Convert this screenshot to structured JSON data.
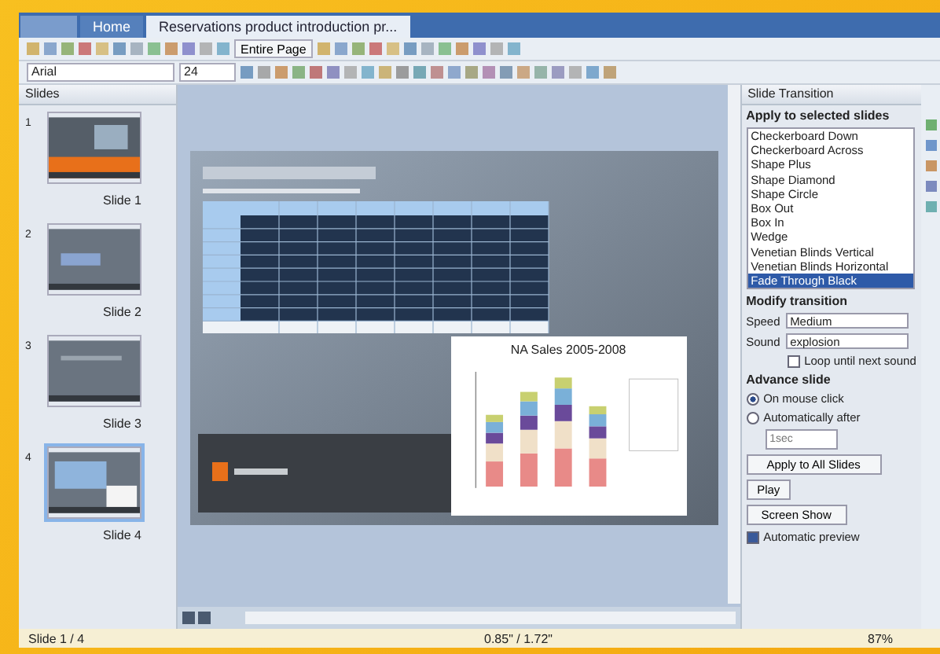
{
  "tabs": [
    {
      "label": "Home",
      "selected": false
    },
    {
      "label": "Reservations product introduction pr...",
      "selected": true
    }
  ],
  "toolbar": {
    "zoom_label": "Entire Page",
    "font": "Arial",
    "font_size": "24"
  },
  "slides_panel": {
    "title": "Slides",
    "slides": [
      {
        "number": "1",
        "label": "Slide 1",
        "selected": false
      },
      {
        "number": "2",
        "label": "Slide 2",
        "selected": false
      },
      {
        "number": "3",
        "label": "Slide 3",
        "selected": false
      },
      {
        "number": "4",
        "label": "Slide 4",
        "selected": true
      }
    ]
  },
  "slide": {
    "chart_title": "NA Sales 2005-2008"
  },
  "transition_panel": {
    "title": "Slide Transition",
    "apply_heading": "Apply to selected slides",
    "effects": [
      {
        "label": "Checkerboard Down",
        "selected": false
      },
      {
        "label": "Checkerboard Across",
        "selected": false
      },
      {
        "label": "Shape Plus",
        "selected": false
      },
      {
        "label": "Shape Diamond",
        "selected": false
      },
      {
        "label": "Shape Circle",
        "selected": false
      },
      {
        "label": "Box Out",
        "selected": false
      },
      {
        "label": "Box In",
        "selected": false
      },
      {
        "label": "Wedge",
        "selected": false
      },
      {
        "label": "Venetian Blinds Vertical",
        "selected": false
      },
      {
        "label": "Venetian Blinds Horizontal",
        "selected": false
      },
      {
        "label": "Fade Through Black",
        "selected": true
      }
    ],
    "modify_heading": "Modify transition",
    "speed_label": "Speed",
    "speed": "Medium",
    "sound_label": "Sound",
    "sound": "explosion",
    "loop": {
      "label": "Loop until next sound",
      "checked": false
    },
    "advance_heading": "Advance slide",
    "advance": [
      {
        "label": "On mouse click",
        "selected": true
      },
      {
        "label": "Automatically after",
        "selected": false
      }
    ],
    "after_placeholder": "1sec",
    "buttons": [
      "Apply to All Slides",
      "Play",
      "Screen Show"
    ],
    "preview": {
      "label": "Automatic preview",
      "checked": true
    }
  },
  "status_bar": {
    "slide": "Slide 1 / 4",
    "position": "0.85\" / 1.72\"",
    "zoom": "87%"
  }
}
